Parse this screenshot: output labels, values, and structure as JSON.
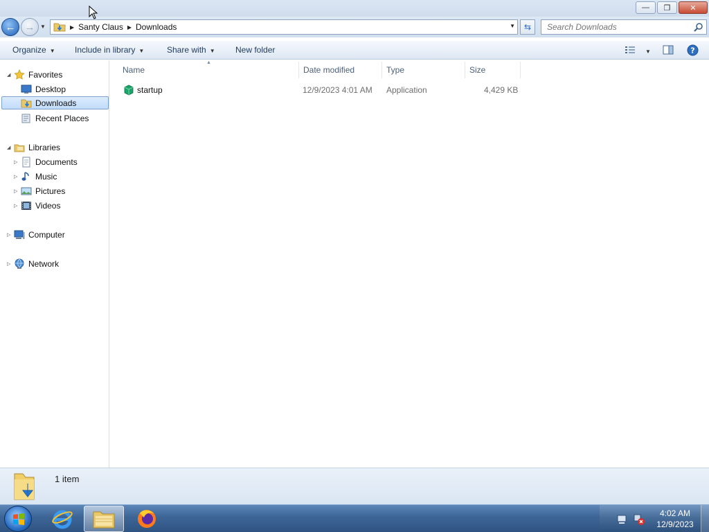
{
  "window": {
    "caption_buttons": {
      "minimize": "—",
      "maximize": "❐",
      "close": "✕"
    }
  },
  "address": {
    "breadcrumbs": [
      "Santy Claus",
      "Downloads"
    ],
    "search_placeholder": "Search Downloads"
  },
  "toolbar": {
    "organize": "Organize",
    "include_in_library": "Include in library",
    "share_with": "Share with",
    "new_folder": "New folder"
  },
  "nav": {
    "favorites": {
      "label": "Favorites",
      "items": [
        {
          "label": "Desktop",
          "icon": "desktop-icon"
        },
        {
          "label": "Downloads",
          "icon": "downloads-folder-icon",
          "selected": true
        },
        {
          "label": "Recent Places",
          "icon": "recent-places-icon"
        }
      ]
    },
    "libraries": {
      "label": "Libraries",
      "items": [
        {
          "label": "Documents",
          "icon": "documents-icon"
        },
        {
          "label": "Music",
          "icon": "music-icon"
        },
        {
          "label": "Pictures",
          "icon": "pictures-icon"
        },
        {
          "label": "Videos",
          "icon": "videos-icon"
        }
      ]
    },
    "computer": "Computer",
    "network": "Network"
  },
  "columns": [
    "Name",
    "Date modified",
    "Type",
    "Size"
  ],
  "files": [
    {
      "name": "startup",
      "date_modified": "12/9/2023 4:01 AM",
      "type": "Application",
      "size": "4,429 KB",
      "icon": "application-icon"
    }
  ],
  "status": {
    "item_count": "1 item"
  },
  "taskbar": {
    "apps": [
      "windows-start-orb-icon",
      "internet-explorer-icon",
      "windows-explorer-icon",
      "firefox-icon"
    ],
    "clock_time": "4:02 AM",
    "clock_date": "12/9/2023"
  },
  "colors": {
    "accent": "#1e395b",
    "selection": "#c1dcfc",
    "taskbar": "#3c6596",
    "app_icon": "#1aa36a"
  }
}
